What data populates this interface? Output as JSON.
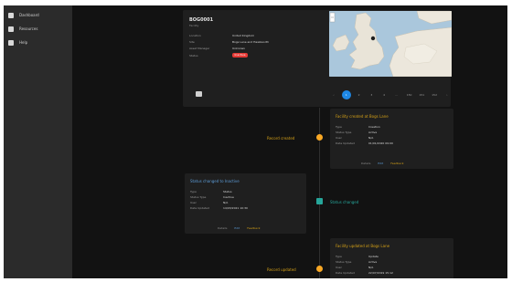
{
  "sidebar": {
    "items": [
      {
        "label": "Dashboard",
        "icon": "grid-icon"
      },
      {
        "label": "Resources",
        "icon": "folder-icon"
      },
      {
        "label": "Help",
        "icon": "help-icon"
      }
    ]
  },
  "header_card": {
    "title": "BOG0001",
    "subtitle": "Facility",
    "rows": [
      {
        "key": "Location",
        "value": "United Kingdom"
      },
      {
        "key": "Site",
        "value": "Bogs Lane and Hawkworth"
      },
      {
        "key": "Asset Manager",
        "value": "Unknown"
      },
      {
        "key": "Status",
        "value": "Inactive"
      }
    ],
    "status_color": "#e53935"
  },
  "pagination": {
    "prev": "‹",
    "pages": [
      "1",
      "2",
      "3",
      "4",
      "…",
      "150",
      "151",
      "152"
    ],
    "active_index": 0,
    "next": "›"
  },
  "timeline": [
    {
      "label": "Record created",
      "color": "#f9a825",
      "card": {
        "title": "Facility created at Bogs Lane",
        "rows": [
          {
            "key": "Type",
            "value": "Creation"
          },
          {
            "key": "Status Type",
            "value": "Active"
          },
          {
            "key": "User",
            "value": "N/A"
          },
          {
            "key": "Date Updated",
            "value": "01/01/2020 09:00"
          }
        ],
        "actions": [
          "Details",
          "Edit",
          "Feedback"
        ]
      }
    },
    {
      "label": "Status changed",
      "color": "#26a69a",
      "card": {
        "title": "Status changed to Inactive",
        "rows": [
          {
            "key": "Type",
            "value": "Status"
          },
          {
            "key": "Status Type",
            "value": "Inactive"
          },
          {
            "key": "User",
            "value": "N/A"
          },
          {
            "key": "Date Updated",
            "value": "14/03/2021 10:30"
          }
        ],
        "actions": [
          "Details",
          "Edit",
          "Feedback"
        ]
      }
    },
    {
      "label": "Record updated",
      "color": "#f9a825",
      "card": {
        "title": "Facility updated at Bogs Lane",
        "rows": [
          {
            "key": "Type",
            "value": "Update"
          },
          {
            "key": "Status Type",
            "value": "Active"
          },
          {
            "key": "User",
            "value": "N/A"
          },
          {
            "key": "Date Updated",
            "value": "22/07/2019 15:12"
          }
        ]
      }
    }
  ]
}
